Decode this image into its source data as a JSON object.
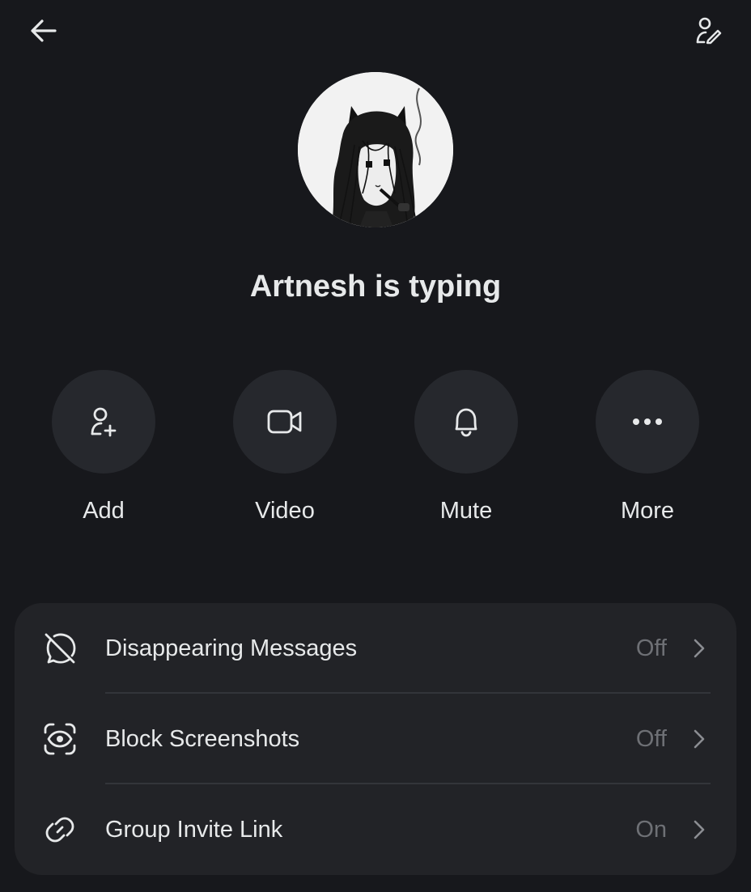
{
  "header": {
    "back_icon": "arrow-left-icon",
    "edit_icon": "person-edit-icon"
  },
  "profile": {
    "title": "Artnesh is typing"
  },
  "actions": [
    {
      "label": "Add",
      "icon": "add-person-icon"
    },
    {
      "label": "Video",
      "icon": "video-camera-icon"
    },
    {
      "label": "Mute",
      "icon": "bell-icon"
    },
    {
      "label": "More",
      "icon": "more-dots-icon"
    }
  ],
  "settings": [
    {
      "label": "Disappearing Messages",
      "value": "Off",
      "icon": "timer-off-icon"
    },
    {
      "label": "Block Screenshots",
      "value": "Off",
      "icon": "screenshot-eye-icon"
    },
    {
      "label": "Group Invite Link",
      "value": "On",
      "icon": "link-icon"
    }
  ],
  "colors": {
    "background": "#17181c",
    "surface": "#222327",
    "action_circle": "#26282d",
    "text": "#e7e9ea",
    "muted": "#6e7075"
  }
}
